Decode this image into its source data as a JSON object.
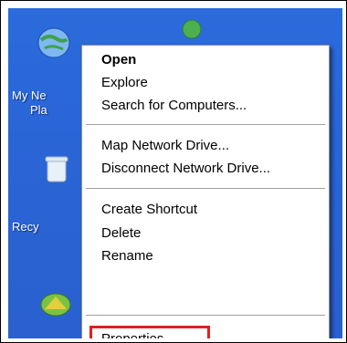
{
  "desktop": {
    "icons": [
      {
        "label_line1": "My Ne",
        "label_line2": "Pla",
        "icon": "network-places-icon"
      },
      {
        "label_line1": "Recy",
        "label_line2": "",
        "icon": "recycle-bin-icon"
      },
      {
        "label_line1": "",
        "label_line2": "",
        "icon": "desktop-shortcut-icon"
      }
    ]
  },
  "context_menu": {
    "open": "Open",
    "explore": "Explore",
    "search_computers": "Search for Computers...",
    "map_drive": "Map Network Drive...",
    "disconnect_drive": "Disconnect Network Drive...",
    "create_shortcut": "Create Shortcut",
    "delete": "Delete",
    "rename": "Rename",
    "properties": "Properties"
  },
  "colors": {
    "desktop_bg": "#2a65d6",
    "menu_bg": "#ffffff",
    "highlight_border": "#e0201c"
  }
}
